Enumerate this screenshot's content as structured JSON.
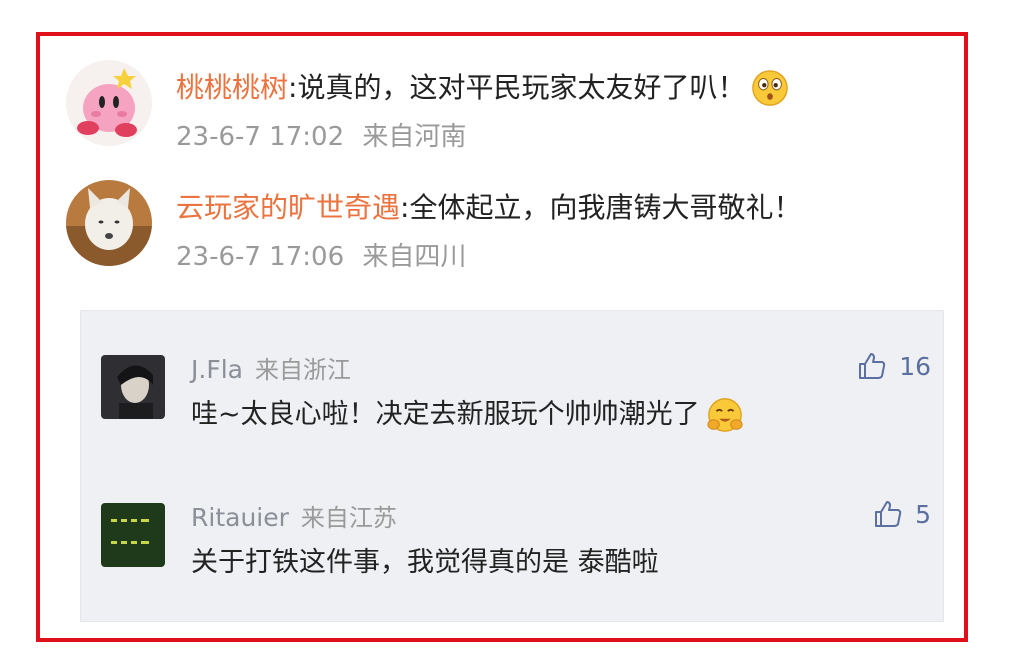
{
  "comments": [
    {
      "username": "桃桃桃树",
      "separator": ":",
      "text": "说真的，这对平民玩家太友好了叭！",
      "emoji_icon": "confused-face-icon",
      "date": "23-6-7 17:02",
      "location": "来自河南"
    },
    {
      "username": "云玩家的旷世奇遇",
      "separator": ":",
      "text": "全体起立，向我唐铸大哥敬礼！",
      "date": "23-6-7 17:06",
      "location": "来自四川"
    }
  ],
  "replies": [
    {
      "username": "J.Fla",
      "location": "来自浙江",
      "text": "哇~太良心啦！决定去新服玩个帅帅潮光了",
      "emoji_icon": "hugging-face-icon",
      "likes": "16",
      "like_icon": "thumbs-up-icon"
    },
    {
      "username": "Ritauier",
      "location": "来自江苏",
      "text": "关于打铁这件事，我觉得真的是 泰酷啦",
      "likes": "5",
      "like_icon": "thumbs-up-icon"
    }
  ],
  "colors": {
    "frame_border": "#e0101a",
    "username": "#eb7340",
    "meta": "#9a9a9a",
    "reply_background": "#eff0f3",
    "like": "#5b6fa0"
  }
}
